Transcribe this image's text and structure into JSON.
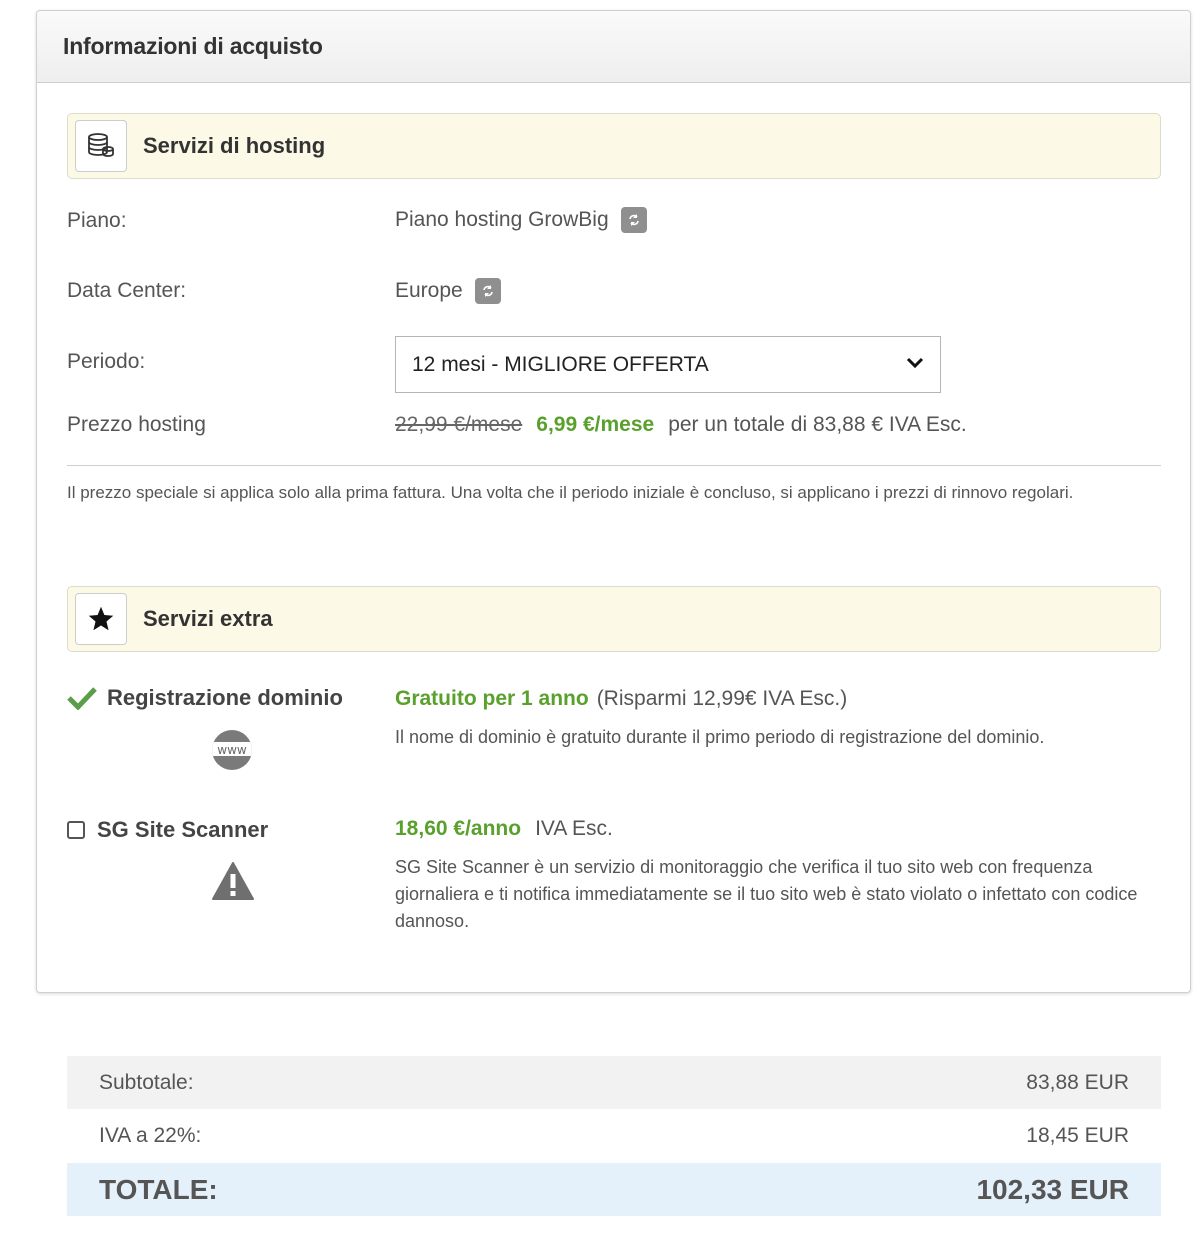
{
  "panel": {
    "title": "Informazioni di acquisto"
  },
  "hosting": {
    "section_title": "Servizi di hosting",
    "icon": "database-icon",
    "plan_label": "Piano:",
    "plan_value": "Piano hosting GrowBig",
    "datacenter_label": "Data Center:",
    "datacenter_value": "Europe",
    "period_label": "Periodo:",
    "period_selected": "12 mesi - MIGLIORE OFFERTA",
    "price_label": "Prezzo hosting",
    "old_price": "22,99 €/mese",
    "new_price": "6,99 €/mese",
    "price_total": "per un totale di 83,88 € IVA Esc.",
    "note": "Il prezzo speciale si applica solo alla prima fattura. Una volta che il periodo iniziale è concluso, si applicano i prezzi di rinnovo regolari."
  },
  "extras": {
    "section_title": "Servizi extra",
    "icon": "star-icon",
    "domain": {
      "name": "Registrazione dominio",
      "checked": true,
      "badge_text": "www",
      "price": "Gratuito per 1 anno",
      "savings": "(Risparmi 12,99€ IVA Esc.)",
      "description": "Il nome di dominio è gratuito durante il primo periodo di registrazione del dominio."
    },
    "scanner": {
      "name": "SG Site Scanner",
      "checked": false,
      "price": "18,60 €/anno",
      "tax": "IVA Esc.",
      "description": "SG Site Scanner è un servizio di monitoraggio che verifica il tuo sito web con frequenza giornaliera e ti notifica immediatamente se il tuo sito web è stato violato o infettato con codice dannoso."
    }
  },
  "summary": {
    "subtotal_label": "Subtotale:",
    "subtotal_value": "83,88 EUR",
    "vat_label": "IVA a 22%:",
    "vat_value": "18,45 EUR",
    "total_label": "TOTALE:",
    "total_value": "102,33 EUR"
  },
  "colors": {
    "accent_green": "#5aa02c",
    "section_bg": "#fcf9e6",
    "total_bg": "#e4f1fb",
    "subtotal_bg": "#f2f2f2"
  }
}
